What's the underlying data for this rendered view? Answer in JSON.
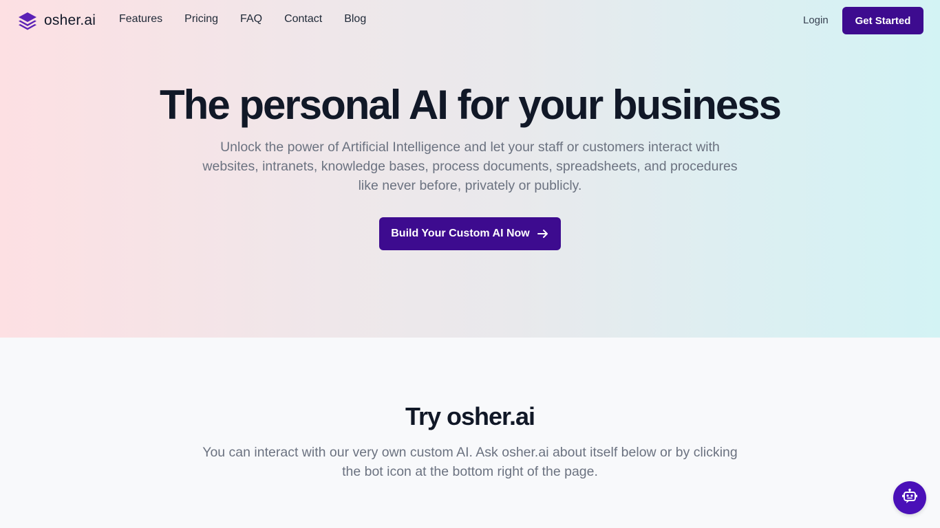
{
  "brand": {
    "name": "osher.ai",
    "logo_icon": "layers-icon",
    "accent": "#3d0b8f"
  },
  "nav": {
    "links": [
      {
        "label": "Features"
      },
      {
        "label": "Pricing"
      },
      {
        "label": "FAQ"
      },
      {
        "label": "Contact"
      },
      {
        "label": "Blog"
      }
    ],
    "login_label": "Login",
    "get_started_label": "Get Started"
  },
  "hero": {
    "title": "The personal AI for your business",
    "subtitle": "Unlock the power of Artificial Intelligence and let your staff or customers interact with websites, intranets, knowledge bases, process documents, spreadsheets, and procedures like never before, privately or publicly.",
    "cta_label": "Build Your Custom AI Now",
    "cta_icon": "arrow-right-icon"
  },
  "try_section": {
    "title": "Try osher.ai",
    "subtitle": "You can interact with our very own custom AI. Ask osher.ai about itself below or by clicking the bot icon at the bottom right of the page."
  },
  "chat_widget": {
    "icon": "robot-chat-icon",
    "color": "#4a10b8"
  }
}
